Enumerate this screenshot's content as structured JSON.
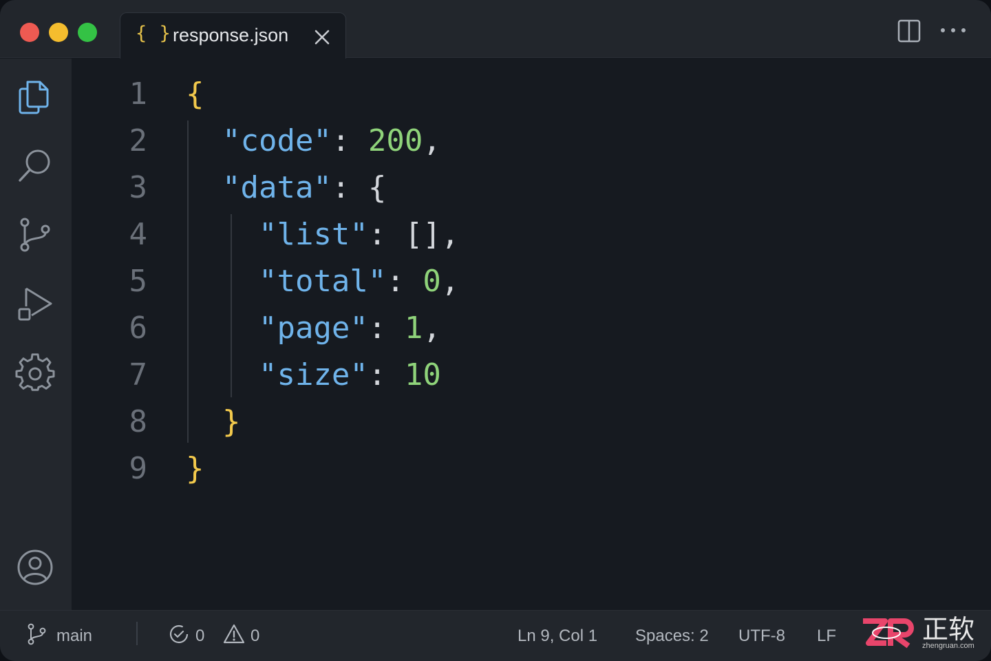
{
  "window": {
    "controls": [
      "close",
      "minimize",
      "zoom"
    ]
  },
  "tab": {
    "icon": "{ }",
    "label": "response.json",
    "icon_name": "json-braces-icon"
  },
  "titlebar_actions": [
    "split-editor-icon",
    "more-actions-icon"
  ],
  "activity_bar": [
    "explorer-icon",
    "search-icon",
    "source-control-icon",
    "run-debug-icon",
    "settings-gear-icon",
    "account-icon"
  ],
  "editor": {
    "line_numbers": [
      "1",
      "2",
      "3",
      "4",
      "5",
      "6",
      "7",
      "8",
      "9"
    ],
    "lines": [
      [
        {
          "t": "{",
          "k": "brace"
        }
      ],
      [
        {
          "t": "  ",
          "k": "punc"
        },
        {
          "t": "\"code\"",
          "k": "key"
        },
        {
          "t": ": ",
          "k": "punc"
        },
        {
          "t": "200",
          "k": "num"
        },
        {
          "t": ",",
          "k": "punc"
        }
      ],
      [
        {
          "t": "  ",
          "k": "punc"
        },
        {
          "t": "\"data\"",
          "k": "key"
        },
        {
          "t": ": {",
          "k": "punc"
        }
      ],
      [
        {
          "t": "    ",
          "k": "punc"
        },
        {
          "t": "\"list\"",
          "k": "key"
        },
        {
          "t": ": [],",
          "k": "punc"
        }
      ],
      [
        {
          "t": "    ",
          "k": "punc"
        },
        {
          "t": "\"total\"",
          "k": "key"
        },
        {
          "t": ": ",
          "k": "punc"
        },
        {
          "t": "0",
          "k": "num"
        },
        {
          "t": ",",
          "k": "punc"
        }
      ],
      [
        {
          "t": "    ",
          "k": "punc"
        },
        {
          "t": "\"page\"",
          "k": "key"
        },
        {
          "t": ": ",
          "k": "punc"
        },
        {
          "t": "1",
          "k": "num"
        },
        {
          "t": ",",
          "k": "punc"
        }
      ],
      [
        {
          "t": "    ",
          "k": "punc"
        },
        {
          "t": "\"size\"",
          "k": "key"
        },
        {
          "t": ": ",
          "k": "punc"
        },
        {
          "t": "10",
          "k": "num"
        }
      ],
      [
        {
          "t": "  ",
          "k": "punc"
        },
        {
          "t": "}",
          "k": "brace"
        }
      ],
      [
        {
          "t": "}",
          "k": "brace"
        }
      ]
    ]
  },
  "statusbar": {
    "branch": "main",
    "errors": "0",
    "warnings": "0",
    "cursor": "Ln 9, Col 1",
    "indent": "Spaces: 2",
    "encoding": "UTF-8",
    "eol": "LF"
  },
  "watermark": {
    "text": "正软",
    "subtext": "zhengruan.com",
    "logo": "ZR"
  },
  "colors": {
    "background": "#161a20",
    "chrome": "#22262c",
    "key": "#6fb3ea",
    "number": "#8fd37a",
    "brace": "#f2c94c",
    "line_number": "#6a7079"
  }
}
